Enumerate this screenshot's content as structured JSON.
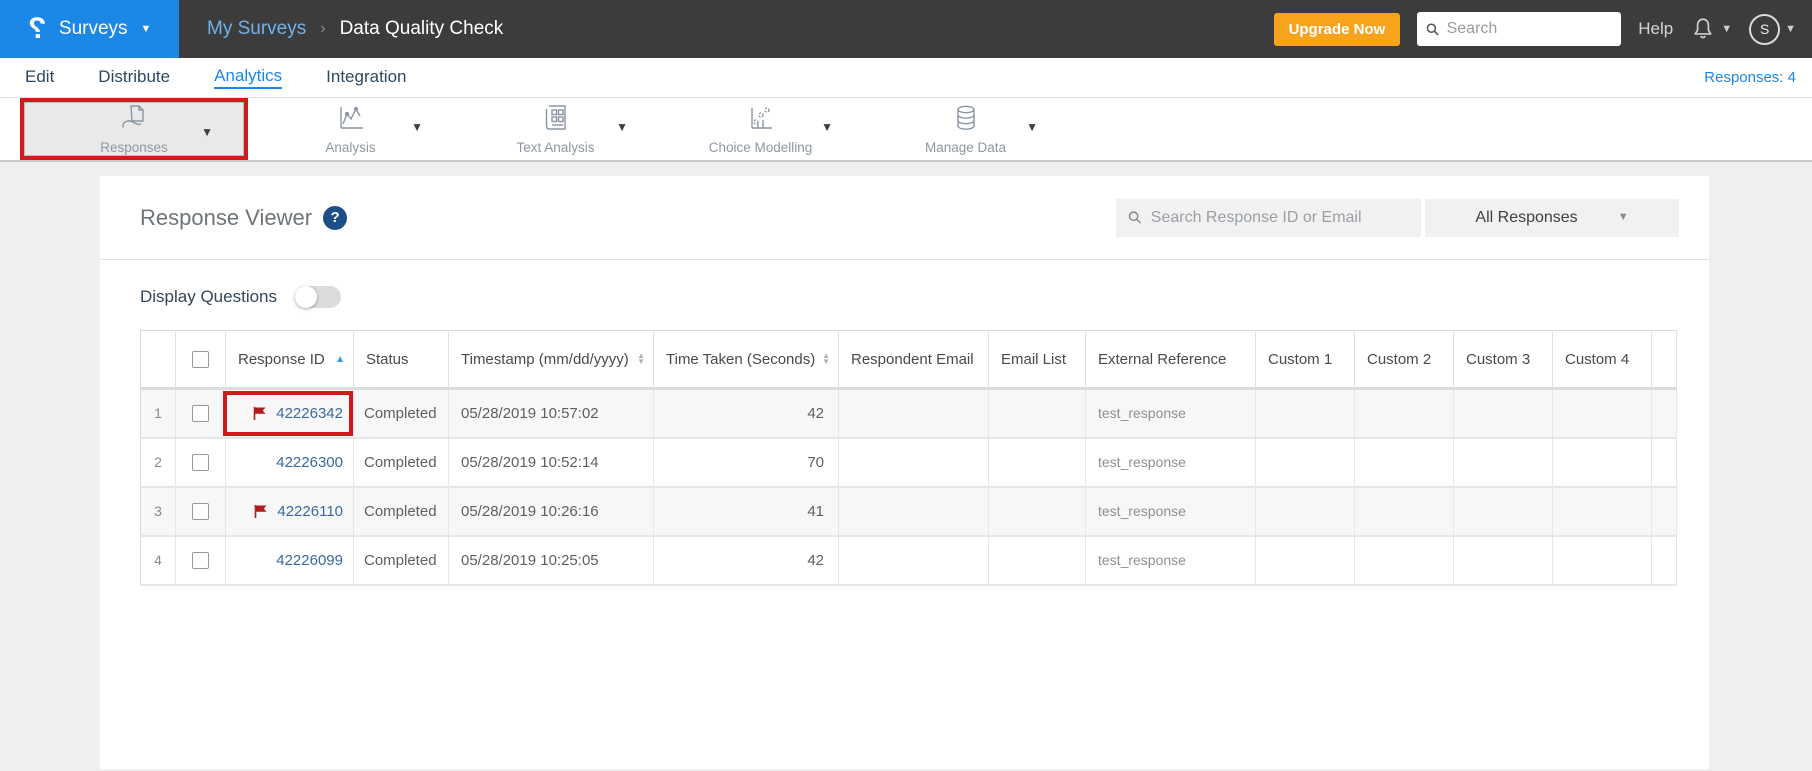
{
  "header": {
    "brand_label": "Surveys",
    "breadcrumb": {
      "parent": "My Surveys",
      "separator": "›",
      "current": "Data Quality Check"
    },
    "upgrade_label": "Upgrade Now",
    "search_placeholder": "Search",
    "help_label": "Help",
    "avatar_initial": "S"
  },
  "nav": {
    "tabs": [
      {
        "label": "Edit",
        "active": false
      },
      {
        "label": "Distribute",
        "active": false
      },
      {
        "label": "Analytics",
        "active": true
      },
      {
        "label": "Integration",
        "active": false
      }
    ],
    "responses_count": "Responses: 4"
  },
  "toolbar": {
    "items": [
      {
        "label": "Responses",
        "icon": "responses-icon",
        "selected": true,
        "annotated": true
      },
      {
        "label": "Analysis",
        "icon": "analysis-icon",
        "selected": false
      },
      {
        "label": "Text Analysis",
        "icon": "text-analysis-icon",
        "selected": false
      },
      {
        "label": "Choice Modelling",
        "icon": "choice-modelling-icon",
        "selected": false
      },
      {
        "label": "Manage Data",
        "icon": "manage-data-icon",
        "selected": false
      }
    ]
  },
  "viewer": {
    "title": "Response Viewer",
    "search_placeholder": "Search Response ID or Email",
    "filter_selected": "All Responses",
    "display_questions_label": "Display Questions",
    "display_questions_on": false
  },
  "table": {
    "columns": [
      "",
      "",
      "Response ID",
      "Status",
      "Timestamp (mm/dd/yyyy)",
      "Time Taken (Seconds)",
      "Respondent Email",
      "Email List",
      "External Reference",
      "Custom 1",
      "Custom 2",
      "Custom 3",
      "Custom 4",
      ""
    ],
    "sort_asc_column_index": 2,
    "sort_both_column_indexes": [
      4,
      5
    ],
    "rows": [
      {
        "num": "1",
        "flagged": true,
        "response_id": "42226342",
        "status": "Completed",
        "timestamp": "05/28/2019 10:57:02",
        "time_taken": "42",
        "respondent_email": "",
        "email_list": "",
        "external_reference": "test_response",
        "custom1": "",
        "custom2": "",
        "custom3": "",
        "custom4": "",
        "annotated": true
      },
      {
        "num": "2",
        "flagged": false,
        "response_id": "42226300",
        "status": "Completed",
        "timestamp": "05/28/2019 10:52:14",
        "time_taken": "70",
        "respondent_email": "",
        "email_list": "",
        "external_reference": "test_response",
        "custom1": "",
        "custom2": "",
        "custom3": "",
        "custom4": "",
        "annotated": false
      },
      {
        "num": "3",
        "flagged": true,
        "response_id": "42226110",
        "status": "Completed",
        "timestamp": "05/28/2019 10:26:16",
        "time_taken": "41",
        "respondent_email": "",
        "email_list": "",
        "external_reference": "test_response",
        "custom1": "",
        "custom2": "",
        "custom3": "",
        "custom4": "",
        "annotated": false
      },
      {
        "num": "4",
        "flagged": false,
        "response_id": "42226099",
        "status": "Completed",
        "timestamp": "05/28/2019 10:25:05",
        "time_taken": "42",
        "respondent_email": "",
        "email_list": "",
        "external_reference": "test_response",
        "custom1": "",
        "custom2": "",
        "custom3": "",
        "custom4": "",
        "annotated": false
      }
    ]
  },
  "colors": {
    "brand_blue": "#1b87e6",
    "topbar_dark": "#3c3c3c",
    "upgrade_orange": "#f7a31c",
    "annotation_red": "#d31a1a",
    "flag_red": "#b11c1c",
    "id_link_blue": "#3a6a9b",
    "help_badge_navy": "#1d4e86",
    "row_stripe": "#f7f7f7"
  }
}
